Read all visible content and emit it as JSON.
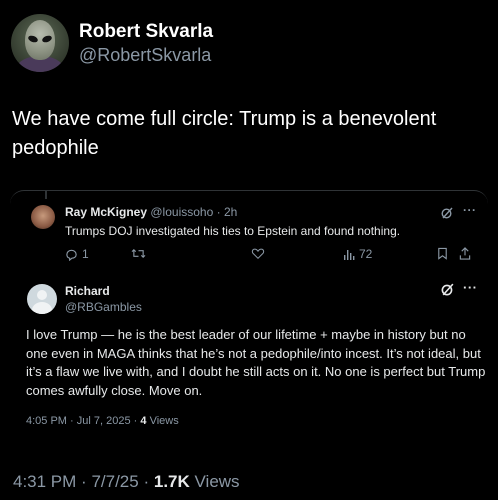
{
  "author": {
    "display_name": "Robert Skvarla",
    "handle": "@RobertSkvarla"
  },
  "tweet": {
    "text": "We have come full circle: Trump is a benevolent pedophile",
    "time": "4:31 PM",
    "date": "7/7/25",
    "views_count": "1.7K",
    "views_label": "Views"
  },
  "embedded": {
    "reply": {
      "name": "Ray McKigney",
      "handle": "@louissoho",
      "age": "2h",
      "text": "Trumps DOJ investigated his ties to Epstein and found nothing.",
      "replies": "1",
      "views": "72"
    },
    "post": {
      "name": "Richard",
      "handle": "@RBGambles",
      "text": "I love Trump — he is the best leader of our lifetime + maybe in history but no one even in MAGA thinks that he’s not a pedophile/into incest.  It’s not ideal, but it’s a flaw we live with, and I doubt he still acts on it.  No one is perfect but Trump comes awfully close. Move on.",
      "time": "4:05 PM",
      "date": "Jul 7, 2025",
      "views_count": "4",
      "views_label": "Views"
    }
  },
  "icons": {
    "grok": "grok-icon",
    "more": "more-icon",
    "reply": "reply-icon",
    "retweet": "retweet-icon",
    "like": "heart-icon",
    "views": "views-icon",
    "bookmark": "bookmark-icon",
    "share": "share-icon"
  }
}
